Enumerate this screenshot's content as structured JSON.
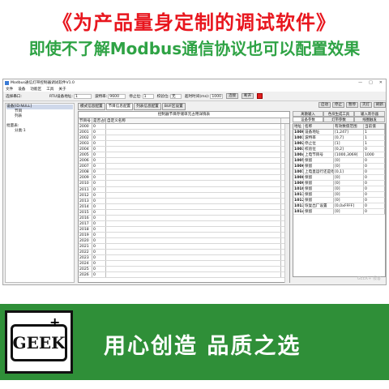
{
  "headline": "《为产品量身定制的调试软件》",
  "subheadline": "即使不了解Modbus通信协议也可以配置效果",
  "window": {
    "title": "Modbus通信灯带控制器调试软件V1.0",
    "controls": [
      "—",
      "□",
      "✕"
    ]
  },
  "menu": [
    "文件",
    "设备",
    "功能区",
    "工具",
    "关于"
  ],
  "toolbar": {
    "device_label": "选择串口:",
    "rtu_label": "RTU设备地址:",
    "rtu_value": "1",
    "baud_label": "波特率:",
    "baud_value": "9600",
    "stop_label": "停止位:",
    "stop_value": "1",
    "parity_label": "校验位:",
    "parity_value": "无",
    "timeout_label": "超时时间(ms):",
    "timeout_value": "1000",
    "connect_label": "连接",
    "disconnect_label": "断开"
  },
  "tree": [
    {
      "label": "设备[ID:NULL]",
      "selected": true
    },
    {
      "label": "节目"
    },
    {
      "label": "列表"
    },
    {
      "label": ""
    },
    {
      "label": "批量表:"
    },
    {
      "label": "分类:1"
    }
  ],
  "mid_tabs": [
    "模式信息配置",
    "节目信息配置",
    "列表信息配置",
    "BUF区设置"
  ],
  "grid": {
    "title": "控制器节目存储单元占用详情表",
    "headers": [
      "节目号",
      "是否占用",
      "自定义名称"
    ],
    "rows": [
      [
        "2000",
        "0"
      ],
      [
        "2001",
        "0"
      ],
      [
        "2002",
        "0"
      ],
      [
        "2003",
        "0"
      ],
      [
        "2004",
        "0"
      ],
      [
        "2005",
        "0"
      ],
      [
        "2006",
        "0"
      ],
      [
        "2007",
        "0"
      ],
      [
        "2008",
        "0"
      ],
      [
        "2009",
        "0"
      ],
      [
        "2010",
        "0"
      ],
      [
        "2011",
        "0"
      ],
      [
        "2012",
        "0"
      ],
      [
        "2013",
        "0"
      ],
      [
        "2014",
        "0"
      ],
      [
        "2015",
        "0"
      ],
      [
        "2016",
        "0"
      ],
      [
        "2017",
        "0"
      ],
      [
        "2018",
        "0"
      ],
      [
        "2019",
        "0"
      ],
      [
        "2020",
        "0"
      ],
      [
        "2021",
        "0"
      ],
      [
        "2022",
        "0"
      ],
      [
        "2023",
        "0"
      ],
      [
        "2024",
        "0"
      ],
      [
        "2025",
        "0"
      ],
      [
        "2026",
        "0"
      ]
    ]
  },
  "right_buttons": [
    "启动",
    "停止",
    "暂停",
    "灭灯",
    "刷新"
  ],
  "right_tabs": [
    "离散输入",
    "色块生成工具",
    "输入寄存器",
    "设备参数",
    "灯带参数",
    "线圈触发"
  ],
  "right_grid": {
    "headers": [
      "地址",
      "名称",
      "有效数值范围",
      "当前值"
    ],
    "rows": [
      [
        "1000",
        "设备地址",
        "[1,247]",
        "1"
      ],
      [
        "1001",
        "波特率",
        "[0,7]",
        "1"
      ],
      [
        "1002",
        "停止位",
        "[1]",
        "1"
      ],
      [
        "1003",
        "校验位",
        "[0,2]",
        "0"
      ],
      [
        "1004",
        "上电节目号",
        "[1000,3069]",
        "1000"
      ],
      [
        "1005",
        "保留",
        "[0]",
        "0"
      ],
      [
        "1006",
        "保留",
        "[0]",
        "0"
      ],
      [
        "1007",
        "上电直运行还是停止",
        "[0,1]",
        "0"
      ],
      [
        "1008",
        "保留",
        "[0]",
        "0"
      ],
      [
        "1009",
        "保留",
        "[0]",
        "0"
      ],
      [
        "1010",
        "保留",
        "[0]",
        "0"
      ],
      [
        "1011",
        "保留",
        "[0]",
        "0"
      ],
      [
        "1012",
        "保留",
        "[0]",
        "0"
      ],
      [
        "1013",
        "恢复出厂设置",
        "[0,0xFFFF]",
        "0"
      ],
      [
        "1014",
        "保留",
        "[0]",
        "0"
      ]
    ]
  },
  "watermark": "GEEK+ 极客",
  "logo": {
    "text": "GEEK",
    "plus": "+"
  },
  "slogan": "用心创造  品质之选",
  "colors": {
    "headline": "#e8161e",
    "subheadline": "#2fa345",
    "banner": "#2f8f38",
    "stop_indicator": "#e02020"
  }
}
